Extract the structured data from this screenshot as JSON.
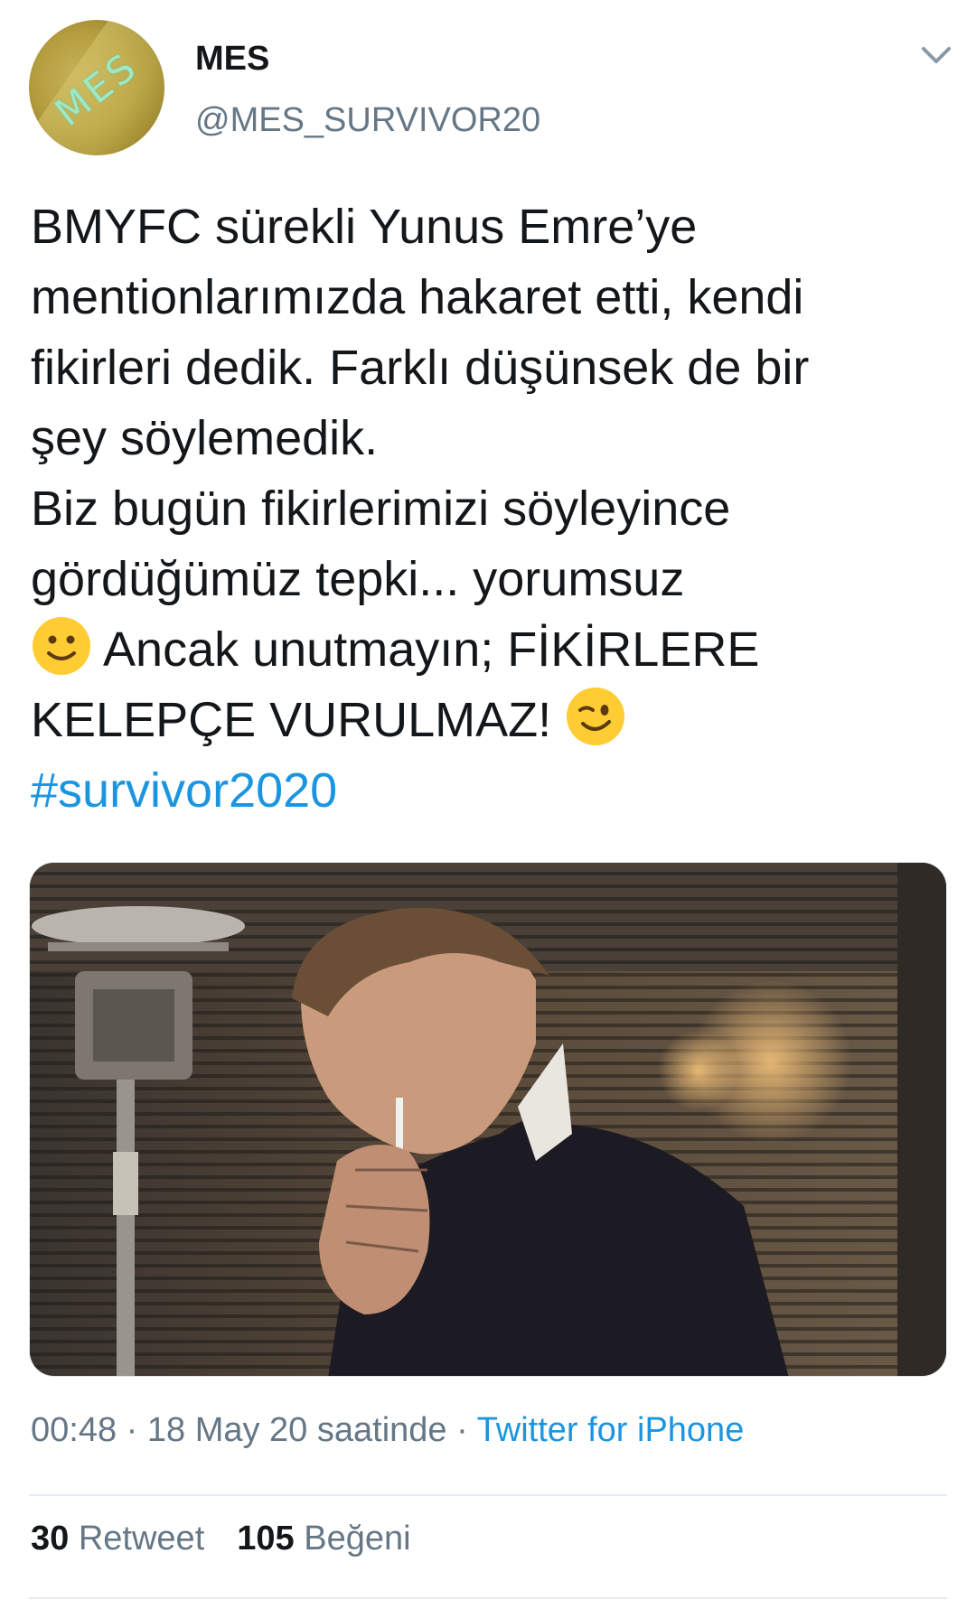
{
  "user": {
    "display_name": "MES",
    "handle": "@MES_SURVIVOR20",
    "avatar_text": "MES"
  },
  "tweet": {
    "lines": [
      "BMYFC sürekli Yunus Emre’ye",
      "mentionlarımızda hakaret etti, kendi",
      "fikirleri dedik. Farklı düşünsek de bir",
      "şey söylemedik.",
      "Biz bugün fikirlerimizi söyleyince",
      "gördüğümüz tepki... yorumsuz"
    ],
    "line7_after_emoji": " Ancak unutmayın; FİKİRLERE",
    "line8_before_emoji": "KELEPÇE VURULMAZ! ",
    "hashtag": "#survivor2020",
    "emoji_1": "slightly-smiling-face",
    "emoji_2": "winking-face"
  },
  "meta": {
    "time": "00:48",
    "separator": " · ",
    "date": "18 May 20 saatinde",
    "source": "Twitter for iPhone"
  },
  "stats": {
    "retweet_count": "30",
    "retweet_label": "Retweet",
    "like_count": "105",
    "like_label": "Beğeni"
  },
  "colors": {
    "link": "#1b95e0",
    "secondary_text": "#657786",
    "primary_text": "#14171a"
  }
}
